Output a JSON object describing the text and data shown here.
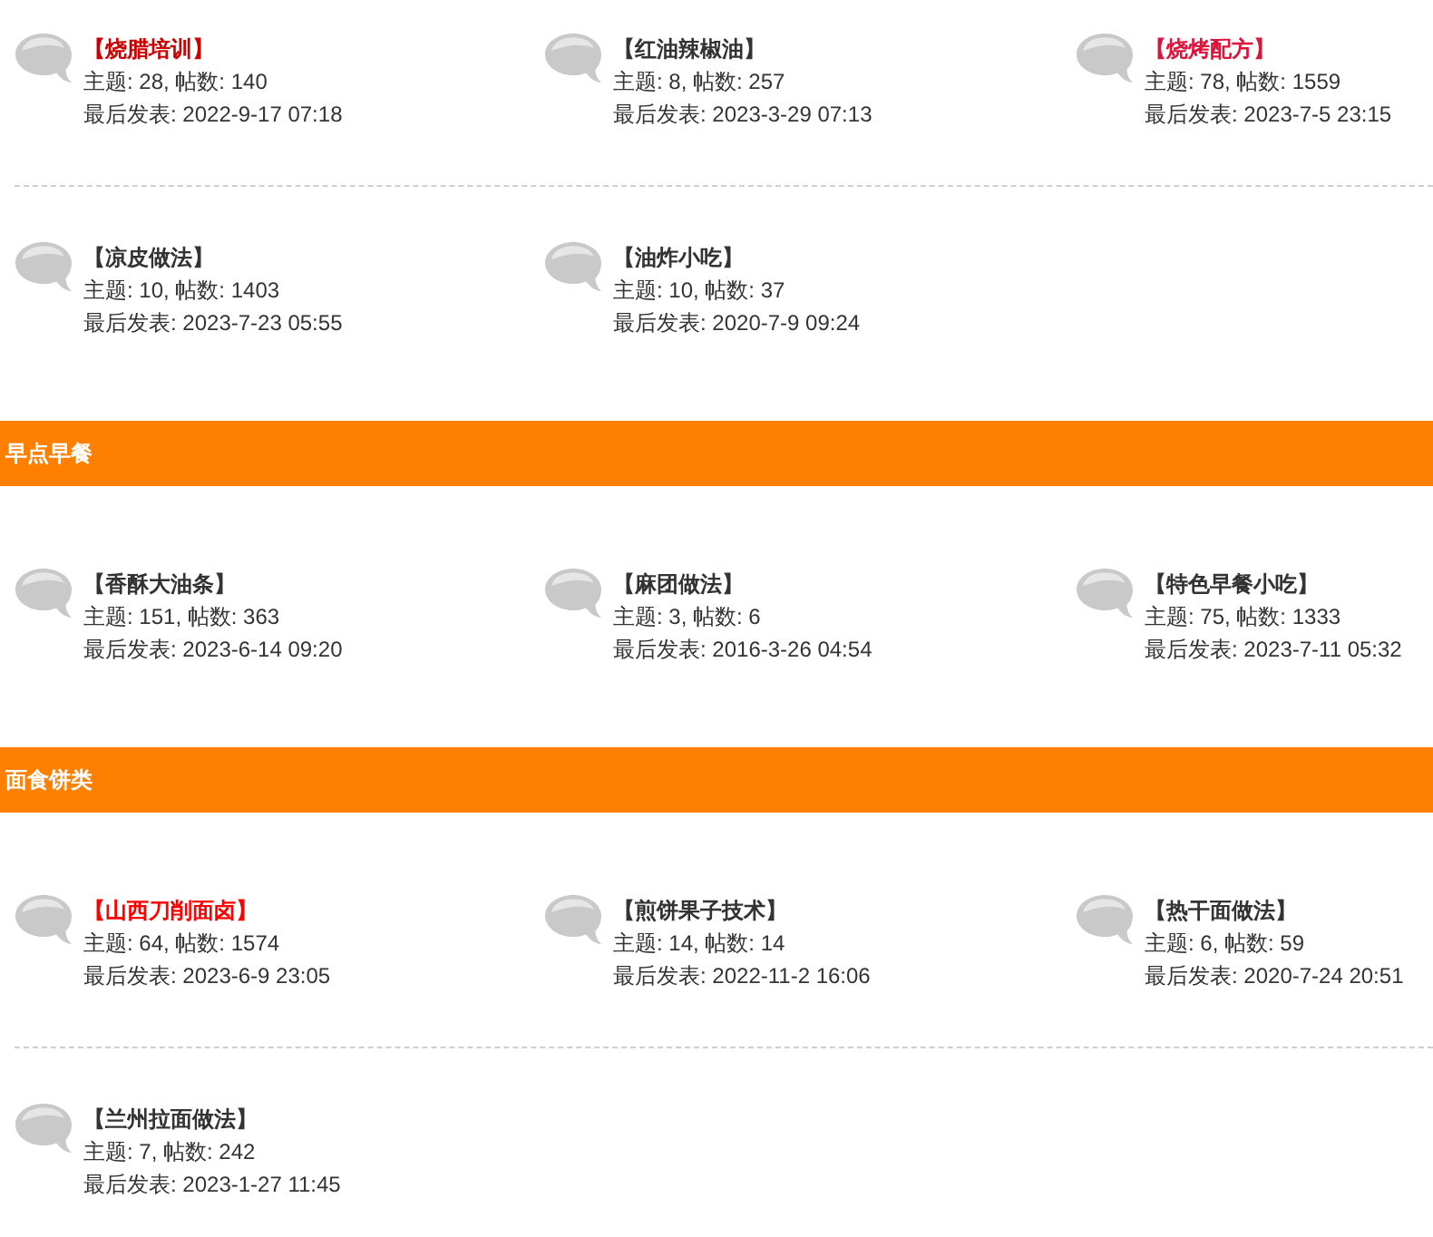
{
  "sections": [
    {
      "rows": [
        [
          {
            "name": "【烧腊培训】",
            "color": "#cc0000",
            "stats": "主题: 28, 帖数: 140",
            "last_post": "最后发表: 2022-9-17 07:18"
          },
          {
            "name": "【红油辣椒油】",
            "color": "#333333",
            "stats": "主题: 8, 帖数: 257",
            "last_post": "最后发表: 2023-3-29 07:13"
          },
          {
            "name": "【烧烤配方】",
            "color": "#dc143c",
            "stats": "主题: 78, 帖数: 1559",
            "last_post": "最后发表: 2023-7-5 23:15"
          }
        ],
        [
          {
            "name": "【凉皮做法】",
            "color": "#333333",
            "stats": "主题: 10, 帖数: 1403",
            "last_post": "最后发表: 2023-7-23 05:55"
          },
          {
            "name": "【油炸小吃】",
            "color": "#333333",
            "stats": "主题: 10, 帖数: 37",
            "last_post": "最后发表: 2020-7-9 09:24"
          }
        ]
      ]
    },
    {
      "title": "早点早餐",
      "rows": [
        [
          {
            "name": "【香酥大油条】",
            "color": "#333333",
            "stats": "主题: 151, 帖数: 363",
            "last_post": "最后发表: 2023-6-14 09:20"
          },
          {
            "name": "【麻团做法】",
            "color": "#333333",
            "stats": "主题: 3, 帖数: 6",
            "last_post": "最后发表: 2016-3-26 04:54"
          },
          {
            "name": "【特色早餐小吃】",
            "color": "#333333",
            "stats": "主题: 75, 帖数: 1333",
            "last_post": "最后发表: 2023-7-11 05:32"
          }
        ]
      ]
    },
    {
      "title": "面食饼类",
      "rows": [
        [
          {
            "name": "【山西刀削面卤】",
            "color": "#ff0000",
            "stats": "主题: 64, 帖数: 1574",
            "last_post": "最后发表: 2023-6-9 23:05"
          },
          {
            "name": "【煎饼果子技术】",
            "color": "#333333",
            "stats": "主题: 14, 帖数: 14",
            "last_post": "最后发表: 2022-11-2 16:06"
          },
          {
            "name": "【热干面做法】",
            "color": "#333333",
            "stats": "主题: 6, 帖数: 59",
            "last_post": "最后发表: 2020-7-24 20:51"
          }
        ],
        [
          {
            "name": "【兰州拉面做法】",
            "color": "#333333",
            "stats": "主题: 7, 帖数: 242",
            "last_post": "最后发表: 2023-1-27 11:45"
          }
        ]
      ]
    }
  ]
}
